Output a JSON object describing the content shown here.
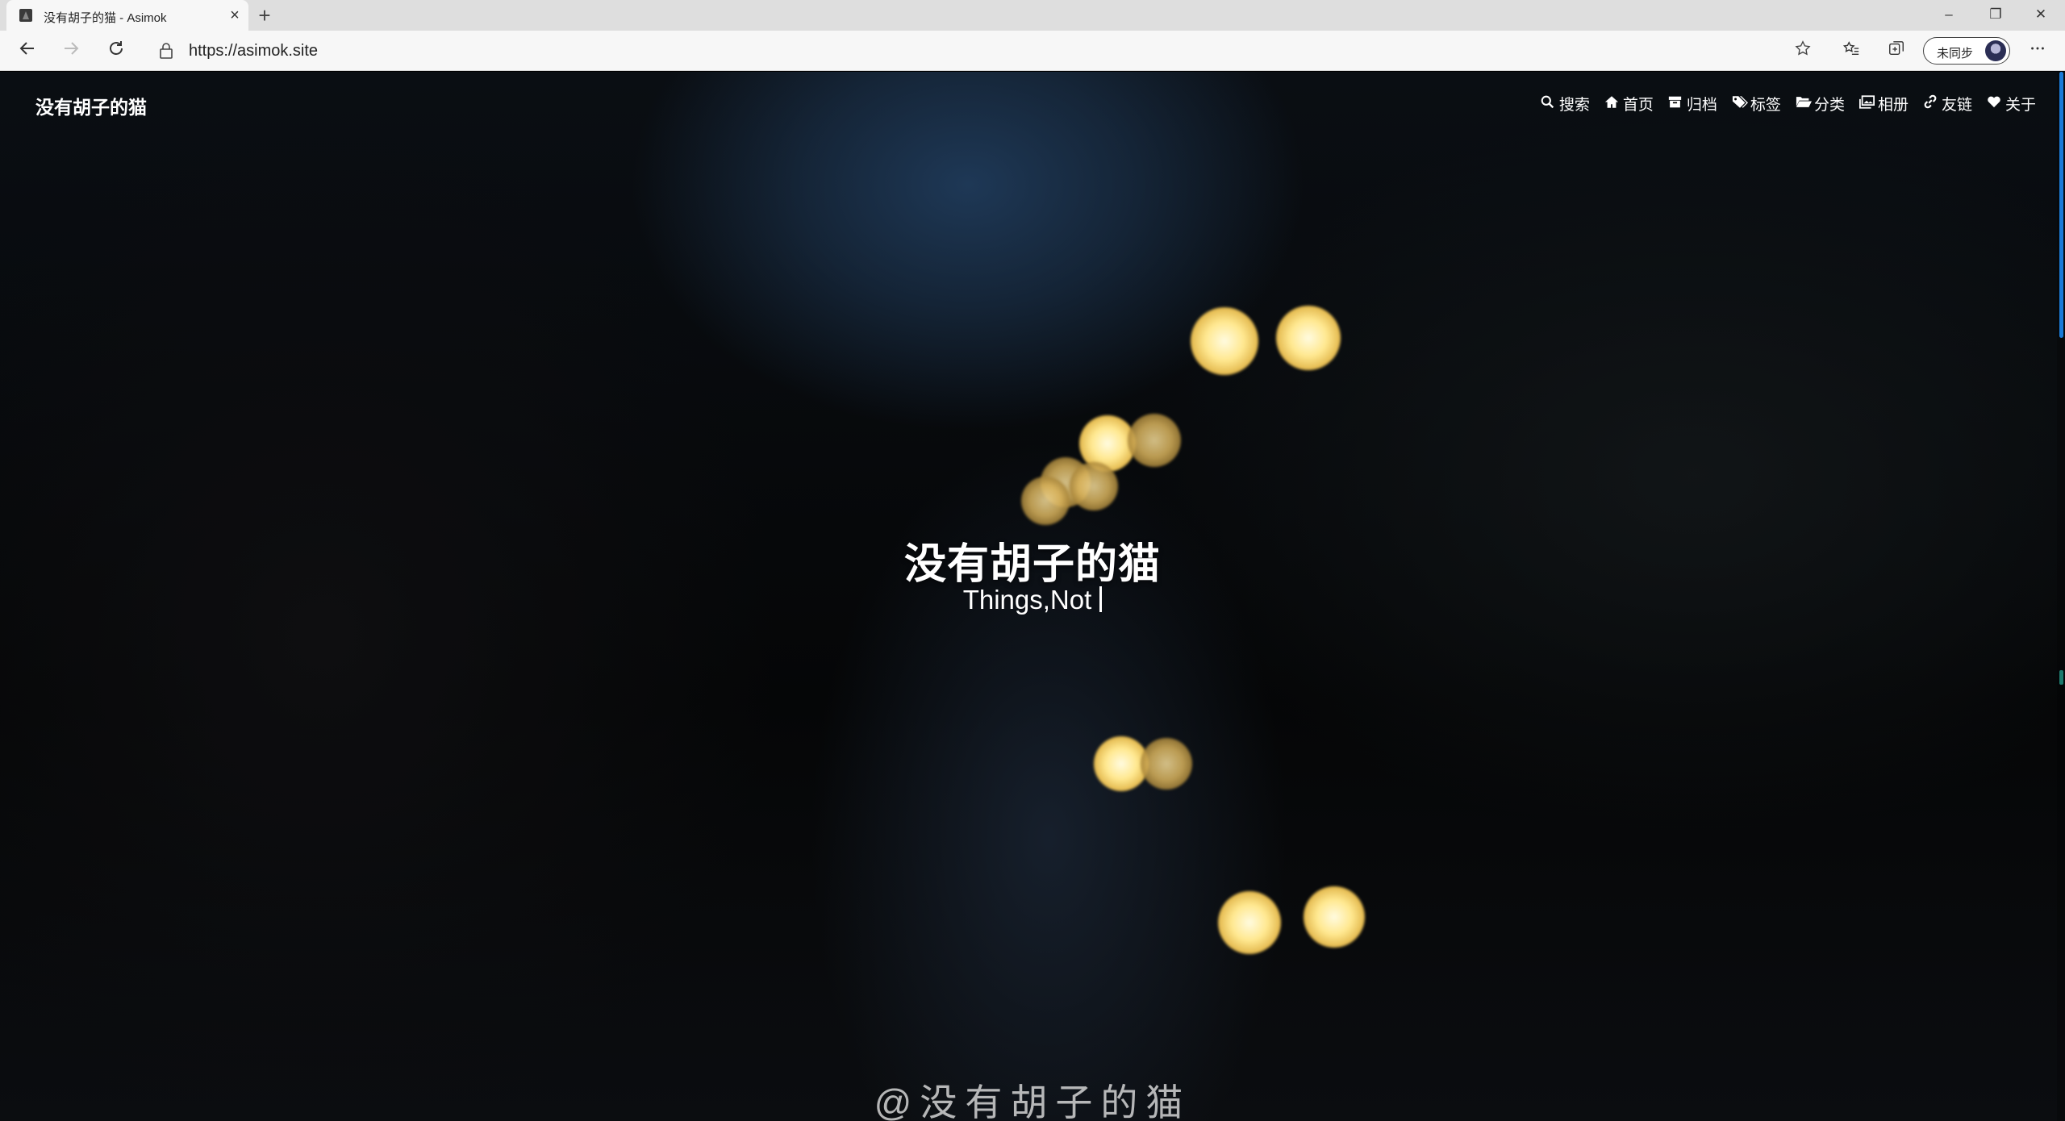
{
  "browser": {
    "tab_title": "没有胡子的猫 - Asimok",
    "tab_close_glyph": "×",
    "new_tab_glyph": "+",
    "url": "https://asimok.site",
    "profile_label": "未同步",
    "window_controls": {
      "minimize": "–",
      "restore": "❐",
      "close": "✕"
    },
    "icons": [
      "back-icon",
      "forward-icon",
      "refresh-icon",
      "lock-icon",
      "star-icon",
      "favorites-icon",
      "collections-icon",
      "more-icon"
    ]
  },
  "site": {
    "brand": "没有胡子的猫",
    "nav": [
      {
        "label": "搜索",
        "icon": "search-icon"
      },
      {
        "label": "首页",
        "icon": "home-icon"
      },
      {
        "label": "归档",
        "icon": "archive-icon"
      },
      {
        "label": "标签",
        "icon": "tags-icon"
      },
      {
        "label": "分类",
        "icon": "folder-icon"
      },
      {
        "label": "相册",
        "icon": "images-icon"
      },
      {
        "label": "友链",
        "icon": "link-icon"
      },
      {
        "label": "关于",
        "icon": "heart-icon"
      }
    ]
  },
  "hero": {
    "title": "没有胡子的猫",
    "subtitle": "Things,Not",
    "watermark": "@没有胡子的猫"
  },
  "colors": {
    "accent_scroll": "#1a7bd8",
    "bokeh": "#ffe890",
    "text": "#ffffff"
  }
}
